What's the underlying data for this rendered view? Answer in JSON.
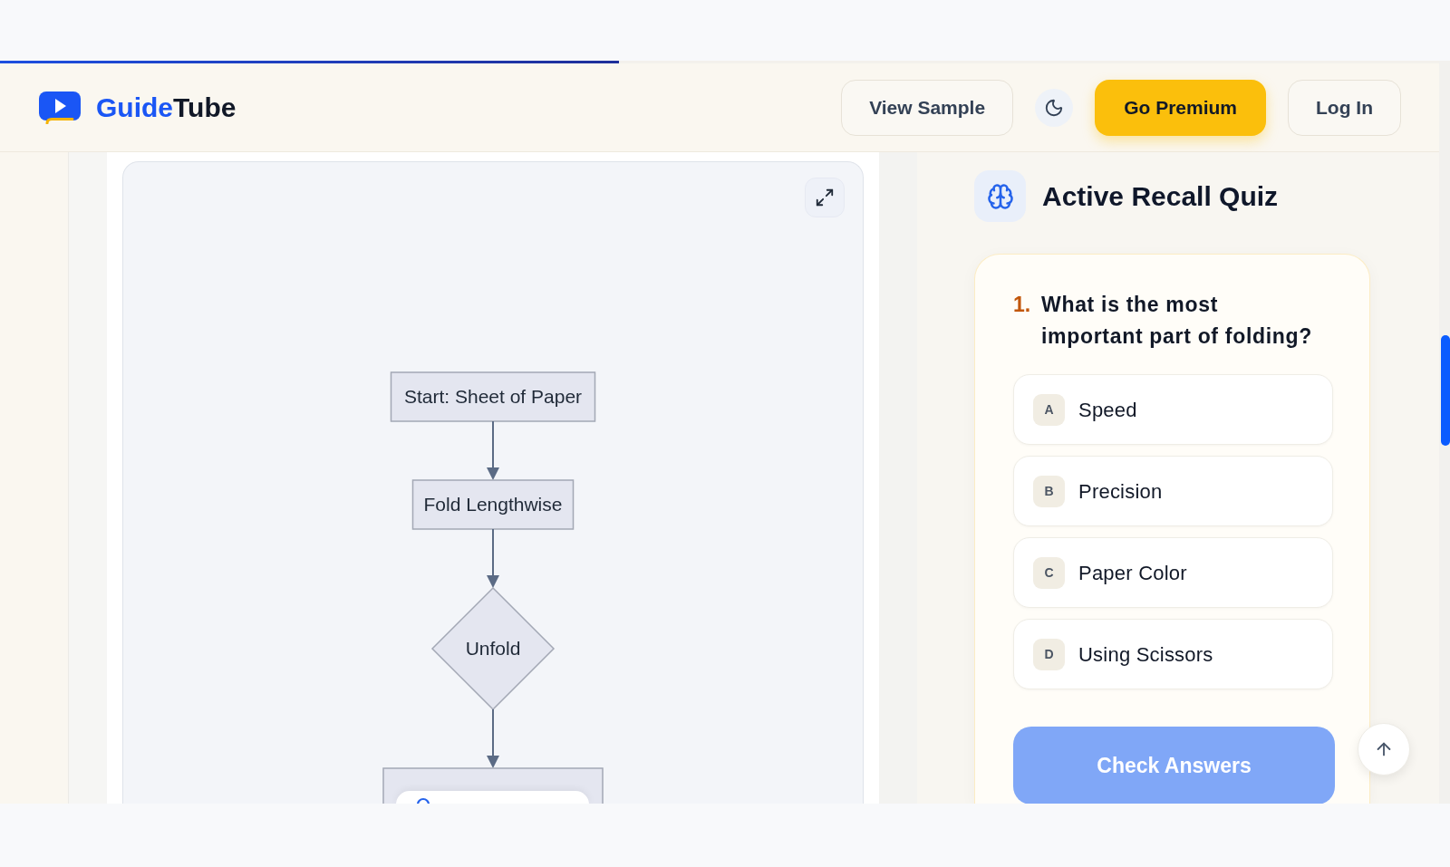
{
  "progress": {
    "level": 0.43
  },
  "header": {
    "logo": {
      "first": "Guide",
      "second": "Tube"
    },
    "buttons": [
      {
        "kind": "outline",
        "label": "View Sample"
      },
      {
        "kind": "theme"
      },
      {
        "kind": "primary",
        "label": "Go Premium"
      },
      {
        "kind": "outline",
        "label": "Log In"
      }
    ]
  },
  "flowchart": {
    "nodes": [
      {
        "kind": "process",
        "label": "Start: Sheet of Paper"
      },
      {
        "kind": "process",
        "label": "Fold Lengthwise"
      },
      {
        "kind": "decision",
        "label": "Unfold"
      },
      {
        "kind": "process"
      }
    ]
  },
  "quiz": {
    "title": "Active Recall Quiz",
    "question": {
      "number": "1.",
      "text": "What is the most important part of folding?"
    },
    "options": [
      {
        "letter": "A",
        "text": "Speed",
        "selected": false
      },
      {
        "letter": "B",
        "text": "Precision",
        "selected": false
      },
      {
        "letter": "C",
        "text": "Paper Color",
        "selected": false
      },
      {
        "letter": "D",
        "text": "Using Scissors",
        "selected": false
      }
    ],
    "submit": {
      "label": "Check Answers",
      "disabled": true
    }
  }
}
